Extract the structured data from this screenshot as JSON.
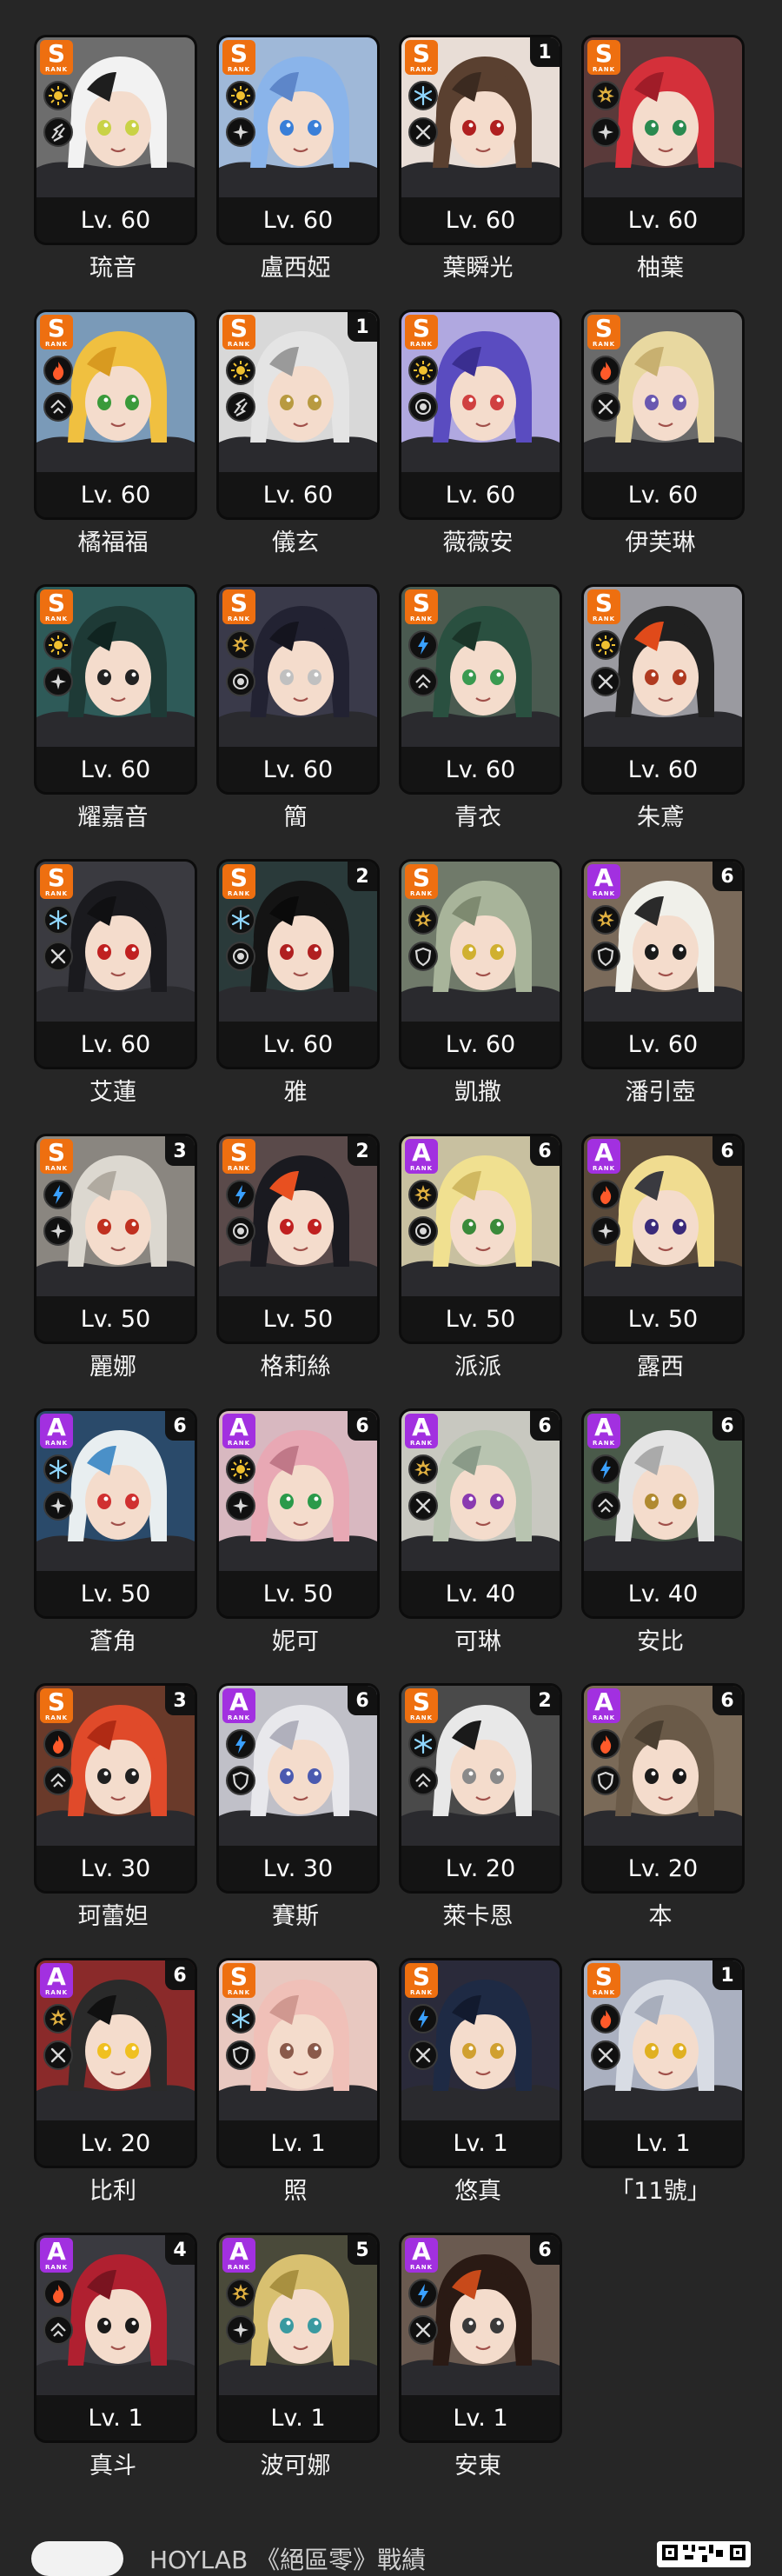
{
  "colors": {
    "background": "#262626",
    "rank_s": "#ee6f10",
    "rank_a": "#a230e0",
    "fire": "#ff5a2a",
    "ether": "#f0c030",
    "electric": "#3aa0ff",
    "ice": "#8fd6ff",
    "physical": "#e0b040"
  },
  "rank_caption": "RANK",
  "agents": [
    {
      "name": "琉音",
      "level": "Lv. 60",
      "rank": "S",
      "mindscape": "",
      "attribute": "ether",
      "role": "rupture",
      "hair": "#f2f2f2",
      "hair2": "#1e1e1e",
      "bg": "#6d6d6d",
      "eye": "#c9d246"
    },
    {
      "name": "盧西婭",
      "level": "Lv. 60",
      "rank": "S",
      "mindscape": "",
      "attribute": "ether",
      "role": "support",
      "hair": "#8ab4ea",
      "hair2": "#5d86c9",
      "bg": "#9fb8d8",
      "eye": "#3a7fd8"
    },
    {
      "name": "葉瞬光",
      "level": "Lv. 60",
      "rank": "S",
      "mindscape": "1",
      "attribute": "ice",
      "role": "attack",
      "hair": "#5a4030",
      "hair2": "#3b2a20",
      "bg": "#e8ddd6",
      "eye": "#b02020"
    },
    {
      "name": "柚葉",
      "level": "Lv. 60",
      "rank": "S",
      "mindscape": "",
      "attribute": "physical",
      "role": "support",
      "hair": "#d4303a",
      "hair2": "#a01c28",
      "bg": "#5a3a3a",
      "eye": "#2a8a50"
    },
    {
      "name": "橘福福",
      "level": "Lv. 60",
      "rank": "S",
      "mindscape": "",
      "attribute": "fire",
      "role": "stun",
      "hair": "#f0c040",
      "hair2": "#d89a20",
      "bg": "#7a9ab8",
      "eye": "#3a9a3a"
    },
    {
      "name": "儀玄",
      "level": "Lv. 60",
      "rank": "S",
      "mindscape": "1",
      "attribute": "ether",
      "role": "rupture",
      "hair": "#e4e4e4",
      "hair2": "#9a9a9a",
      "bg": "#d8d8d8",
      "eye": "#b89a40"
    },
    {
      "name": "薇薇安",
      "level": "Lv. 60",
      "rank": "S",
      "mindscape": "",
      "attribute": "ether",
      "role": "anomaly",
      "hair": "#5a4cc0",
      "hair2": "#3a2e90",
      "bg": "#b0a8e0",
      "eye": "#d04040"
    },
    {
      "name": "伊芙琳",
      "level": "Lv. 60",
      "rank": "S",
      "mindscape": "",
      "attribute": "fire",
      "role": "attack",
      "hair": "#e8d8a0",
      "hair2": "#c8b070",
      "bg": "#6a6a6a",
      "eye": "#6a58b0"
    },
    {
      "name": "耀嘉音",
      "level": "Lv. 60",
      "rank": "S",
      "mindscape": "",
      "attribute": "ether",
      "role": "support",
      "hair": "#1e3a36",
      "hair2": "#102420",
      "bg": "#2e5a58",
      "eye": "#222222"
    },
    {
      "name": "簡",
      "level": "Lv. 60",
      "rank": "S",
      "mindscape": "",
      "attribute": "physical",
      "role": "anomaly",
      "hair": "#222232",
      "hair2": "#14141e",
      "bg": "#3a3a4a",
      "eye": "#c0c0c0"
    },
    {
      "name": "青衣",
      "level": "Lv. 60",
      "rank": "S",
      "mindscape": "",
      "attribute": "electric",
      "role": "stun",
      "hair": "#2a5040",
      "hair2": "#1a3428",
      "bg": "#4a5a50",
      "eye": "#3a9a50"
    },
    {
      "name": "朱鳶",
      "level": "Lv. 60",
      "rank": "S",
      "mindscape": "",
      "attribute": "ether",
      "role": "attack",
      "hair": "#202020",
      "hair2": "#e04a1a",
      "bg": "#9a9aa0",
      "eye": "#b03a20"
    },
    {
      "name": "艾蓮",
      "level": "Lv. 60",
      "rank": "S",
      "mindscape": "",
      "attribute": "ice",
      "role": "attack",
      "hair": "#1a1a1e",
      "hair2": "#101012",
      "bg": "#3a3a40",
      "eye": "#c02020"
    },
    {
      "name": "雅",
      "level": "Lv. 60",
      "rank": "S",
      "mindscape": "2",
      "attribute": "ice",
      "role": "anomaly",
      "hair": "#141414",
      "hair2": "#0a0a0a",
      "bg": "#2a3a3a",
      "eye": "#b02020"
    },
    {
      "name": "凱撒",
      "level": "Lv. 60",
      "rank": "S",
      "mindscape": "",
      "attribute": "physical",
      "role": "defense",
      "hair": "#a8b49a",
      "hair2": "#7e8a70",
      "bg": "#707a6a",
      "eye": "#d0b030"
    },
    {
      "name": "潘引壺",
      "level": "Lv. 60",
      "rank": "A",
      "mindscape": "6",
      "attribute": "physical",
      "role": "defense",
      "hair": "#f0f0ea",
      "hair2": "#2a2a2a",
      "bg": "#7a6a5a",
      "eye": "#1a1a1a"
    },
    {
      "name": "麗娜",
      "level": "Lv. 50",
      "rank": "S",
      "mindscape": "3",
      "attribute": "electric",
      "role": "support",
      "hair": "#dcd8d0",
      "hair2": "#b0aaa0",
      "bg": "#8a8680",
      "eye": "#c03020"
    },
    {
      "name": "格莉絲",
      "level": "Lv. 50",
      "rank": "S",
      "mindscape": "2",
      "attribute": "electric",
      "role": "anomaly",
      "hair": "#1a1a20",
      "hair2": "#e85020",
      "bg": "#5a4a4a",
      "eye": "#c02020"
    },
    {
      "name": "派派",
      "level": "Lv. 50",
      "rank": "A",
      "mindscape": "6",
      "attribute": "physical",
      "role": "anomaly",
      "hair": "#f0e090",
      "hair2": "#d0b860",
      "bg": "#c8c0a0",
      "eye": "#3a8a3a"
    },
    {
      "name": "露西",
      "level": "Lv. 50",
      "rank": "A",
      "mindscape": "6",
      "attribute": "fire",
      "role": "support",
      "hair": "#f0dc90",
      "hair2": "#3a3a40",
      "bg": "#5a4a3a",
      "eye": "#3a2a7a"
    },
    {
      "name": "蒼角",
      "level": "Lv. 50",
      "rank": "A",
      "mindscape": "6",
      "attribute": "ice",
      "role": "support",
      "hair": "#e8eef0",
      "hair2": "#4a90c8",
      "bg": "#2a4a6a",
      "eye": "#d03030"
    },
    {
      "name": "妮可",
      "level": "Lv. 50",
      "rank": "A",
      "mindscape": "6",
      "attribute": "ether",
      "role": "support",
      "hair": "#e8a8b4",
      "hair2": "#c07888",
      "bg": "#d8b8c0",
      "eye": "#2a9a4a"
    },
    {
      "name": "可琳",
      "level": "Lv. 40",
      "rank": "A",
      "mindscape": "6",
      "attribute": "physical",
      "role": "attack",
      "hair": "#b8c4b0",
      "hair2": "#8a9a88",
      "bg": "#c8c8c0",
      "eye": "#8a3ab0"
    },
    {
      "name": "安比",
      "level": "Lv. 40",
      "rank": "A",
      "mindscape": "6",
      "attribute": "electric",
      "role": "stun",
      "hair": "#e4e4e4",
      "hair2": "#aaaaaa",
      "bg": "#4a5a4a",
      "eye": "#b08a30"
    },
    {
      "name": "珂蕾妲",
      "level": "Lv. 30",
      "rank": "S",
      "mindscape": "3",
      "attribute": "fire",
      "role": "stun",
      "hair": "#e04a2a",
      "hair2": "#b02a14",
      "bg": "#6a3a2a",
      "eye": "#202020"
    },
    {
      "name": "賽斯",
      "level": "Lv. 30",
      "rank": "A",
      "mindscape": "6",
      "attribute": "electric",
      "role": "defense",
      "hair": "#e8e8ec",
      "hair2": "#b0b0bc",
      "bg": "#c0c0c8",
      "eye": "#4a5ab0"
    },
    {
      "name": "萊卡恩",
      "level": "Lv. 20",
      "rank": "S",
      "mindscape": "2",
      "attribute": "ice",
      "role": "stun",
      "hair": "#e8e8e8",
      "hair2": "#1a1a1a",
      "bg": "#4a4a4a",
      "eye": "#8a8a8a"
    },
    {
      "name": "本",
      "level": "Lv. 20",
      "rank": "A",
      "mindscape": "6",
      "attribute": "fire",
      "role": "defense",
      "hair": "#6a5a48",
      "hair2": "#4a3e30",
      "bg": "#7a6a58",
      "eye": "#1a1a1a"
    },
    {
      "name": "比利",
      "level": "Lv. 20",
      "rank": "A",
      "mindscape": "6",
      "attribute": "physical",
      "role": "attack",
      "hair": "#2a2a2a",
      "hair2": "#101010",
      "bg": "#8a2a2a",
      "eye": "#f0c020"
    },
    {
      "name": "照",
      "level": "Lv. 1",
      "rank": "S",
      "mindscape": "",
      "attribute": "ice",
      "role": "defense",
      "hair": "#f0c0b8",
      "hair2": "#d09890",
      "bg": "#e8c8c0",
      "eye": "#8a5a4a"
    },
    {
      "name": "悠真",
      "level": "Lv. 1",
      "rank": "S",
      "mindscape": "",
      "attribute": "electric",
      "role": "attack",
      "hair": "#1e2a44",
      "hair2": "#121a2e",
      "bg": "#2a2a3a",
      "eye": "#d0a030"
    },
    {
      "name": "「11號」",
      "level": "Lv. 1",
      "rank": "S",
      "mindscape": "1",
      "attribute": "fire",
      "role": "attack",
      "hair": "#d8dce4",
      "hair2": "#a8aebc",
      "bg": "#aab0c0",
      "eye": "#e0b020"
    },
    {
      "name": "真斗",
      "level": "Lv. 1",
      "rank": "A",
      "mindscape": "4",
      "attribute": "fire",
      "role": "stun",
      "hair": "#b02030",
      "hair2": "#7a1420",
      "bg": "#3a3a40",
      "eye": "#1a1a1a"
    },
    {
      "name": "波可娜",
      "level": "Lv. 1",
      "rank": "A",
      "mindscape": "5",
      "attribute": "physical",
      "role": "support",
      "hair": "#d8c070",
      "hair2": "#a89040",
      "bg": "#4a4a3a",
      "eye": "#3a9aa0"
    },
    {
      "name": "安東",
      "level": "Lv. 1",
      "rank": "A",
      "mindscape": "6",
      "attribute": "electric",
      "role": "attack",
      "hair": "#2a1a14",
      "hair2": "#c84a1a",
      "bg": "#6a5a50",
      "eye": "#3a3a3a"
    }
  ],
  "footer": {
    "text": "HOYLAB 《絕區零》戰績"
  }
}
